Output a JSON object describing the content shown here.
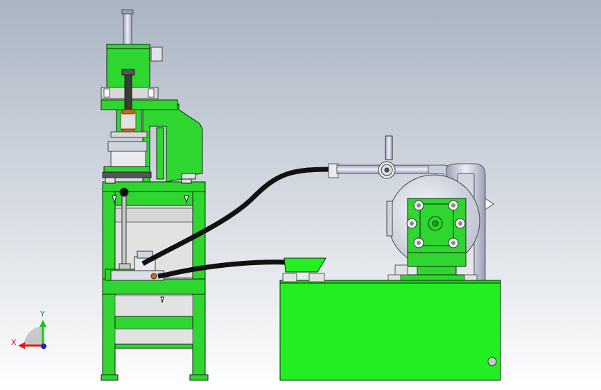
{
  "viewport": {
    "background_top": "#a9b4c3",
    "background_bottom": "#ffffff"
  },
  "colors": {
    "machine_green": "#2fd62f",
    "tank_green": "#22ee22",
    "outline": "#0c260c",
    "hose": "#111111",
    "pipe": "#c8cde0",
    "light_gray": "#e2e2e2",
    "steel": "#b7c1cf",
    "copper": "#c86a10"
  },
  "triad": {
    "x_label": "X",
    "y_label": "Y",
    "x_color": "#e01919",
    "y_color": "#19c619",
    "z_color": "#1d1dd6"
  },
  "parts": [
    "press-frame",
    "hydraulic-cylinder",
    "hydraulic-tank",
    "motor-pump-unit",
    "pressure-gauge",
    "pressure-hose",
    "return-hose"
  ]
}
